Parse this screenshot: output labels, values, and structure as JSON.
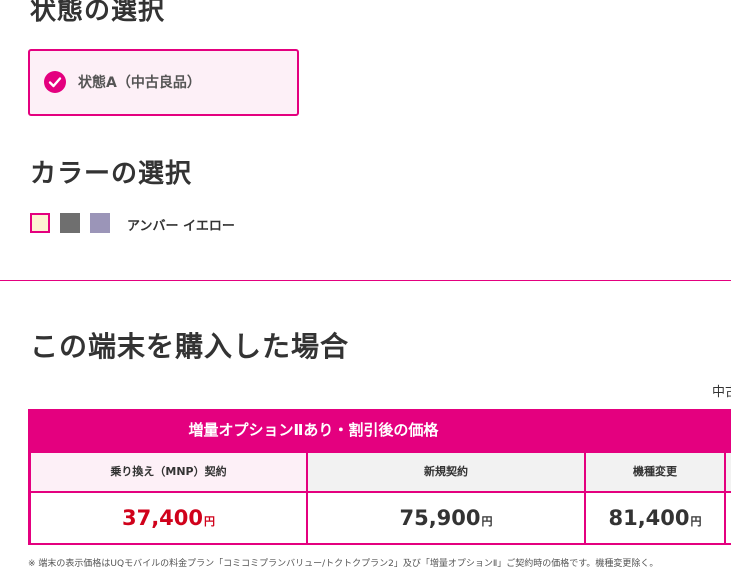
{
  "state_section": {
    "title": "状態の選択",
    "selected_option": "状態A（中古良品）"
  },
  "color_section": {
    "title": "カラーの選択",
    "selected_color_name": "アンバー イエロー",
    "swatches": [
      {
        "name": "amber-yellow",
        "color": "#fdf3d3",
        "selected": true
      },
      {
        "name": "gray",
        "color": "#6f6f6f",
        "selected": false
      },
      {
        "name": "lavender",
        "color": "#9b95b8",
        "selected": false
      }
    ]
  },
  "purchase_section": {
    "title": "この端末を購入した場合",
    "cut_off_label": "中古",
    "table": {
      "header": "増量オプションⅡあり・割引後の価格",
      "columns": [
        {
          "label": "乗り換え（MNP）契約",
          "price": "37,400",
          "unit": "円",
          "highlight": true
        },
        {
          "label": "新規契約",
          "price": "75,900",
          "unit": "円",
          "highlight": false
        },
        {
          "label": "機種変更",
          "price": "81,400",
          "unit": "円",
          "highlight": false
        },
        {
          "label": "",
          "price": "",
          "unit": "",
          "highlight": false
        }
      ]
    },
    "footnote": "※ 端末の表示価格はUQモバイルの料金プラン「コミコミプランバリュー/トクトクプラン2」及び「増量オプションⅡ」ご契約時の価格です。機種変更除く。"
  },
  "colors": {
    "accent": "#e4007f",
    "accent_light": "#fdf0f7",
    "price_highlight": "#d0021b"
  }
}
